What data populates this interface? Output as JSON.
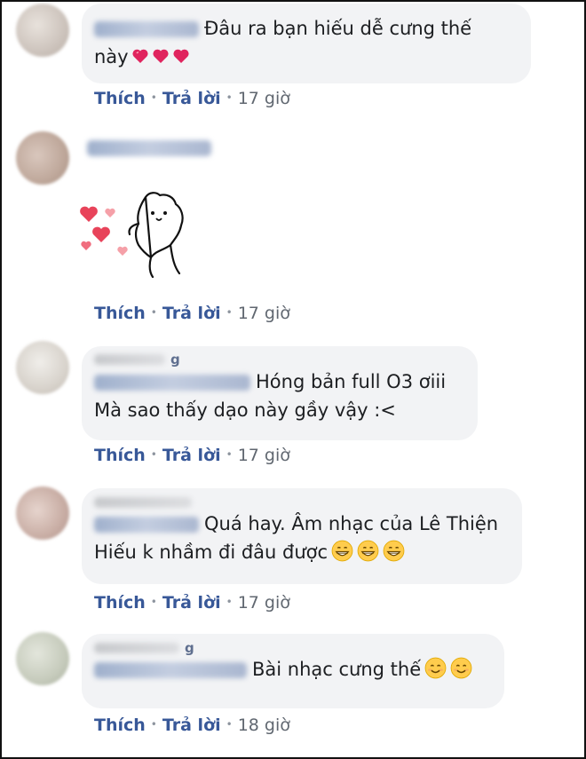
{
  "comments": [
    {
      "text_line1": "Đâu ra bạn hiếu dễ cưng thế",
      "text_line2": "này",
      "actions": {
        "like": "Thích",
        "reply": "Trả lời",
        "time": "17 giờ"
      }
    },
    {
      "sticker": "heart-bunny-sticker",
      "actions": {
        "like": "Thích",
        "reply": "Trả lời",
        "time": "17 giờ"
      }
    },
    {
      "name_tail_top": "g",
      "text_line1": "Hóng bản full O3 ơiii",
      "text_line2": "Mà sao thấy dạo này gầy vậy :<",
      "actions": {
        "like": "Thích",
        "reply": "Trả lời",
        "time": "17 giờ"
      }
    },
    {
      "text_line1": "Quá hay. Âm nhạc của Lê Thiện",
      "text_line2": "Hiếu k nhầm đi đâu được",
      "emoji": "grinning-face",
      "actions": {
        "like": "Thích",
        "reply": "Trả lời",
        "time": "17 giờ"
      }
    },
    {
      "name_tail_top": "g",
      "text_line1": "Bài nhạc cưng thế",
      "emoji": "smiling-face",
      "actions": {
        "like": "Thích",
        "reply": "Trả lời",
        "time": "18 giờ"
      }
    }
  ],
  "colors": {
    "link": "#385898",
    "bubble": "#f2f3f5",
    "meta": "#606770"
  }
}
